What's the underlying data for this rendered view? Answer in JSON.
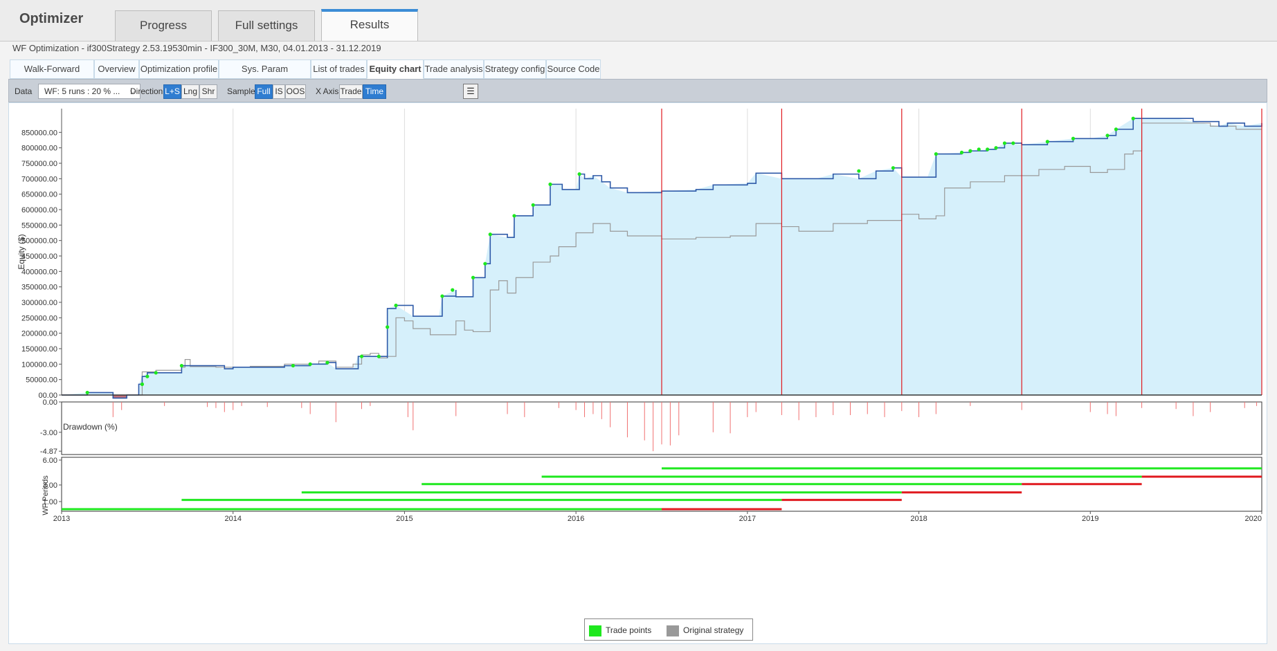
{
  "app": {
    "title": "Optimizer"
  },
  "main_tabs": [
    {
      "label": "Progress"
    },
    {
      "label": "Full settings"
    },
    {
      "label": "Results"
    }
  ],
  "subtitle": "WF Optimization - if300Strategy 2.53.19530min - IF300_30M, M30, 04.01.2013 - 31.12.2019",
  "sub_tabs": [
    {
      "label": "Walk-Forward Results"
    },
    {
      "label": "Overview"
    },
    {
      "label": "Optimization profile"
    },
    {
      "label": "Sys. Param Permutation"
    },
    {
      "label": "List of trades"
    },
    {
      "label": "Equity chart"
    },
    {
      "label": "Trade analysis"
    },
    {
      "label": "Strategy config"
    },
    {
      "label": "Source Code"
    }
  ],
  "toolbar": {
    "data_label": "Data",
    "data_value": "WF: 5 runs : 20 % ...",
    "direction_label": "Direction",
    "direction_buttons": [
      "L+S",
      "Lng",
      "Shr"
    ],
    "sample_label": "Sample",
    "sample_buttons": [
      "Full",
      "IS",
      "OOS"
    ],
    "xaxis_label": "X Axis",
    "xaxis_buttons": [
      "Trade",
      "Time"
    ]
  },
  "colors": {
    "accent": "#2f7dd1",
    "equity": "#2e5aa8",
    "fill": "#d6f0fb",
    "original": "#999999",
    "oos_line": "#e0191e",
    "trade_point": "#1ee81e",
    "drawdown": "#f07070"
  },
  "chart_data": {
    "type": "line",
    "ylabel": "Equity ($)",
    "y_ticks": [
      "00.00",
      "50000.00",
      "100000.00",
      "150000.00",
      "200000.00",
      "250000.00",
      "300000.00",
      "350000.00",
      "400000.00",
      "450000.00",
      "500000.00",
      "550000.00",
      "600000.00",
      "650000.00",
      "700000.00",
      "750000.00",
      "800000.00",
      "850000.00"
    ],
    "ylim": [
      0,
      900000
    ],
    "xlim": [
      2013.0,
      2020.0
    ],
    "x_ticks": [
      "2013",
      "2014",
      "2015",
      "2016",
      "2017",
      "2018",
      "2019",
      "2020"
    ],
    "watermark_years": [
      "2013",
      "2014",
      "2015",
      "2016",
      "2017",
      "2018",
      "2019"
    ],
    "oos_boundaries": [
      2016.5,
      2017.2,
      2017.9,
      2018.6,
      2019.3,
      2020.0
    ],
    "series": [
      {
        "key": "equity",
        "points": [
          [
            2013.0,
            0
          ],
          [
            2013.15,
            8000
          ],
          [
            2013.3,
            8000
          ],
          [
            2013.3,
            -10000
          ],
          [
            2013.38,
            -10000
          ],
          [
            2013.38,
            0
          ],
          [
            2013.45,
            0
          ],
          [
            2013.45,
            35000
          ],
          [
            2013.47,
            60000
          ],
          [
            2013.5,
            72000
          ],
          [
            2013.7,
            72000
          ],
          [
            2013.7,
            95000
          ],
          [
            2013.85,
            95000
          ],
          [
            2013.95,
            85000
          ],
          [
            2014.0,
            90000
          ],
          [
            2014.3,
            95000
          ],
          [
            2014.45,
            100000
          ],
          [
            2014.55,
            105000
          ],
          [
            2014.6,
            85000
          ],
          [
            2014.7,
            85000
          ],
          [
            2014.73,
            125000
          ],
          [
            2014.85,
            125000
          ],
          [
            2014.9,
            120000
          ],
          [
            2014.9,
            280000
          ],
          [
            2014.95,
            290000
          ],
          [
            2015.05,
            255000
          ],
          [
            2015.2,
            255000
          ],
          [
            2015.22,
            320000
          ],
          [
            2015.3,
            340000
          ],
          [
            2015.3,
            318000
          ],
          [
            2015.4,
            318000
          ],
          [
            2015.4,
            380000
          ],
          [
            2015.47,
            380000
          ],
          [
            2015.47,
            425000
          ],
          [
            2015.5,
            520000
          ],
          [
            2015.6,
            510000
          ],
          [
            2015.63,
            510000
          ],
          [
            2015.64,
            580000
          ],
          [
            2015.75,
            580000
          ],
          [
            2015.75,
            615000
          ],
          [
            2015.85,
            615000
          ],
          [
            2015.85,
            682000
          ],
          [
            2015.92,
            682000
          ],
          [
            2015.92,
            665000
          ],
          [
            2016.0,
            665000
          ],
          [
            2016.02,
            715000
          ],
          [
            2016.05,
            700000
          ],
          [
            2016.1,
            710000
          ],
          [
            2016.15,
            690000
          ],
          [
            2016.2,
            670000
          ],
          [
            2016.3,
            655000
          ],
          [
            2016.5,
            660000
          ],
          [
            2016.7,
            665000
          ],
          [
            2016.8,
            680000
          ],
          [
            2017.0,
            685000
          ],
          [
            2017.05,
            718000
          ],
          [
            2017.2,
            700000
          ],
          [
            2017.4,
            700000
          ],
          [
            2017.5,
            715000
          ],
          [
            2017.65,
            700000
          ],
          [
            2017.75,
            725000
          ],
          [
            2017.85,
            735000
          ],
          [
            2017.9,
            705000
          ],
          [
            2018.05,
            705000
          ],
          [
            2018.1,
            780000
          ],
          [
            2018.25,
            785000
          ],
          [
            2018.3,
            790000
          ],
          [
            2018.4,
            795000
          ],
          [
            2018.45,
            800000
          ],
          [
            2018.5,
            815000
          ],
          [
            2018.6,
            810000
          ],
          [
            2018.75,
            820000
          ],
          [
            2018.9,
            830000
          ],
          [
            2019.0,
            830000
          ],
          [
            2019.1,
            840000
          ],
          [
            2019.15,
            860000
          ],
          [
            2019.25,
            895000
          ],
          [
            2019.5,
            895000
          ],
          [
            2019.6,
            885000
          ],
          [
            2019.75,
            870000
          ],
          [
            2019.8,
            880000
          ],
          [
            2019.9,
            870000
          ],
          [
            2020.0,
            880000
          ]
        ]
      },
      {
        "key": "original",
        "points": [
          [
            2013.45,
            0
          ],
          [
            2013.47,
            75000
          ],
          [
            2013.55,
            80000
          ],
          [
            2013.7,
            90000
          ],
          [
            2013.72,
            115000
          ],
          [
            2013.75,
            92000
          ],
          [
            2013.9,
            90000
          ],
          [
            2014.1,
            93000
          ],
          [
            2014.3,
            100000
          ],
          [
            2014.5,
            110000
          ],
          [
            2014.6,
            90000
          ],
          [
            2014.7,
            100000
          ],
          [
            2014.75,
            130000
          ],
          [
            2014.8,
            135000
          ],
          [
            2014.85,
            120000
          ],
          [
            2014.9,
            125000
          ],
          [
            2014.95,
            250000
          ],
          [
            2015.0,
            240000
          ],
          [
            2015.05,
            215000
          ],
          [
            2015.15,
            195000
          ],
          [
            2015.25,
            195000
          ],
          [
            2015.3,
            240000
          ],
          [
            2015.35,
            210000
          ],
          [
            2015.4,
            205000
          ],
          [
            2015.5,
            340000
          ],
          [
            2015.55,
            370000
          ],
          [
            2015.6,
            330000
          ],
          [
            2015.65,
            380000
          ],
          [
            2015.75,
            430000
          ],
          [
            2015.85,
            450000
          ],
          [
            2015.9,
            480000
          ],
          [
            2016.0,
            525000
          ],
          [
            2016.1,
            555000
          ],
          [
            2016.2,
            530000
          ],
          [
            2016.3,
            515000
          ],
          [
            2016.5,
            505000
          ],
          [
            2016.7,
            510000
          ],
          [
            2016.9,
            515000
          ],
          [
            2017.05,
            555000
          ],
          [
            2017.2,
            545000
          ],
          [
            2017.3,
            530000
          ],
          [
            2017.5,
            555000
          ],
          [
            2017.7,
            565000
          ],
          [
            2017.9,
            585000
          ],
          [
            2018.0,
            570000
          ],
          [
            2018.1,
            580000
          ],
          [
            2018.15,
            670000
          ],
          [
            2018.3,
            690000
          ],
          [
            2018.5,
            710000
          ],
          [
            2018.7,
            730000
          ],
          [
            2018.85,
            740000
          ],
          [
            2019.0,
            720000
          ],
          [
            2019.1,
            730000
          ],
          [
            2019.2,
            780000
          ],
          [
            2019.25,
            790000
          ],
          [
            2019.3,
            880000
          ],
          [
            2019.5,
            880000
          ],
          [
            2019.7,
            870000
          ],
          [
            2019.85,
            860000
          ],
          [
            2020.0,
            860000
          ]
        ]
      }
    ],
    "trade_points": [
      [
        2013.15,
        8000
      ],
      [
        2013.47,
        35000
      ],
      [
        2013.5,
        60000
      ],
      [
        2013.55,
        72000
      ],
      [
        2013.7,
        95000
      ],
      [
        2014.35,
        95000
      ],
      [
        2014.45,
        100000
      ],
      [
        2014.55,
        105000
      ],
      [
        2014.75,
        125000
      ],
      [
        2014.85,
        125000
      ],
      [
        2014.9,
        220000
      ],
      [
        2014.95,
        290000
      ],
      [
        2015.22,
        320000
      ],
      [
        2015.28,
        340000
      ],
      [
        2015.4,
        380000
      ],
      [
        2015.47,
        425000
      ],
      [
        2015.5,
        520000
      ],
      [
        2015.64,
        580000
      ],
      [
        2015.75,
        615000
      ],
      [
        2015.85,
        682000
      ],
      [
        2016.02,
        715000
      ],
      [
        2017.65,
        725000
      ],
      [
        2017.85,
        735000
      ],
      [
        2018.1,
        780000
      ],
      [
        2018.25,
        785000
      ],
      [
        2018.3,
        790000
      ],
      [
        2018.35,
        795000
      ],
      [
        2018.4,
        795000
      ],
      [
        2018.45,
        800000
      ],
      [
        2018.5,
        815000
      ],
      [
        2018.55,
        815000
      ],
      [
        2018.75,
        820000
      ],
      [
        2018.9,
        830000
      ],
      [
        2019.1,
        840000
      ],
      [
        2019.15,
        860000
      ],
      [
        2019.25,
        895000
      ]
    ],
    "drawdown": {
      "label": "Drawdown (%)",
      "y_ticks": [
        "0.00",
        "-3.00",
        "-4.87"
      ],
      "ylim": [
        -5.2,
        0
      ],
      "bars": [
        [
          2013.3,
          -1.5
        ],
        [
          2013.35,
          -0.8
        ],
        [
          2013.6,
          -0.4
        ],
        [
          2013.85,
          -0.5
        ],
        [
          2013.9,
          -0.6
        ],
        [
          2013.95,
          -1.0
        ],
        [
          2014.0,
          -0.8
        ],
        [
          2014.05,
          -0.4
        ],
        [
          2014.2,
          -0.5
        ],
        [
          2014.4,
          -0.6
        ],
        [
          2014.45,
          -1.2
        ],
        [
          2014.6,
          -2.0
        ],
        [
          2014.75,
          -0.7
        ],
        [
          2014.8,
          -0.4
        ],
        [
          2015.02,
          -1.5
        ],
        [
          2015.05,
          -2.8
        ],
        [
          2015.3,
          -1.4
        ],
        [
          2015.6,
          -1.2
        ],
        [
          2015.7,
          -1.5
        ],
        [
          2015.9,
          -0.6
        ],
        [
          2016.0,
          -0.8
        ],
        [
          2016.05,
          -1.5
        ],
        [
          2016.1,
          -1.2
        ],
        [
          2016.15,
          -1.7
        ],
        [
          2016.2,
          -2.5
        ],
        [
          2016.3,
          -3.5
        ],
        [
          2016.4,
          -3.8
        ],
        [
          2016.45,
          -4.87
        ],
        [
          2016.5,
          -4.2
        ],
        [
          2016.55,
          -4.3
        ],
        [
          2016.6,
          -3.3
        ],
        [
          2016.8,
          -3.0
        ],
        [
          2016.9,
          -3.1
        ],
        [
          2017.0,
          -1.5
        ],
        [
          2017.05,
          -1.0
        ],
        [
          2017.2,
          -1.3
        ],
        [
          2017.3,
          -1.8
        ],
        [
          2017.4,
          -1.5
        ],
        [
          2017.5,
          -1.3
        ],
        [
          2017.6,
          -1.3
        ],
        [
          2017.7,
          -1.2
        ],
        [
          2017.8,
          -1.5
        ],
        [
          2017.9,
          -0.9
        ],
        [
          2018.0,
          -1.5
        ],
        [
          2018.1,
          -1.2
        ],
        [
          2018.3,
          -0.4
        ],
        [
          2018.6,
          -0.8
        ],
        [
          2019.0,
          -1.0
        ],
        [
          2019.1,
          -1.2
        ],
        [
          2019.15,
          -1.4
        ],
        [
          2019.3,
          -0.6
        ],
        [
          2019.5,
          -0.7
        ],
        [
          2019.6,
          -1.4
        ],
        [
          2019.7,
          -1.0
        ],
        [
          2019.9,
          -0.6
        ],
        [
          2019.97,
          -0.4
        ]
      ]
    },
    "wf_periods": {
      "label": "WF Periods",
      "y_ticks": [
        "6.00",
        "3.00",
        "1.00"
      ],
      "ylim": [
        0,
        6
      ],
      "runs": [
        {
          "y": 0,
          "is": [
            2013.0,
            2016.5
          ],
          "oos": [
            2016.5,
            2017.2
          ]
        },
        {
          "y": 1.2,
          "is": [
            2013.7,
            2017.2
          ],
          "oos": [
            2017.2,
            2017.9
          ]
        },
        {
          "y": 2.1,
          "is": [
            2014.4,
            2017.9
          ],
          "oos": [
            2017.9,
            2018.6
          ]
        },
        {
          "y": 3.1,
          "is": [
            2015.1,
            2018.6
          ],
          "oos": [
            2018.6,
            2019.3
          ]
        },
        {
          "y": 4.0,
          "is": [
            2015.8,
            2019.3
          ],
          "oos": [
            2019.3,
            2020.0
          ]
        },
        {
          "y": 5.0,
          "is": [
            2016.5,
            2020.0
          ],
          "oos": null
        }
      ]
    },
    "legend": [
      {
        "label": "Trade points",
        "color": "#1ee81e"
      },
      {
        "label": "Original strategy",
        "color": "#999999"
      }
    ]
  }
}
